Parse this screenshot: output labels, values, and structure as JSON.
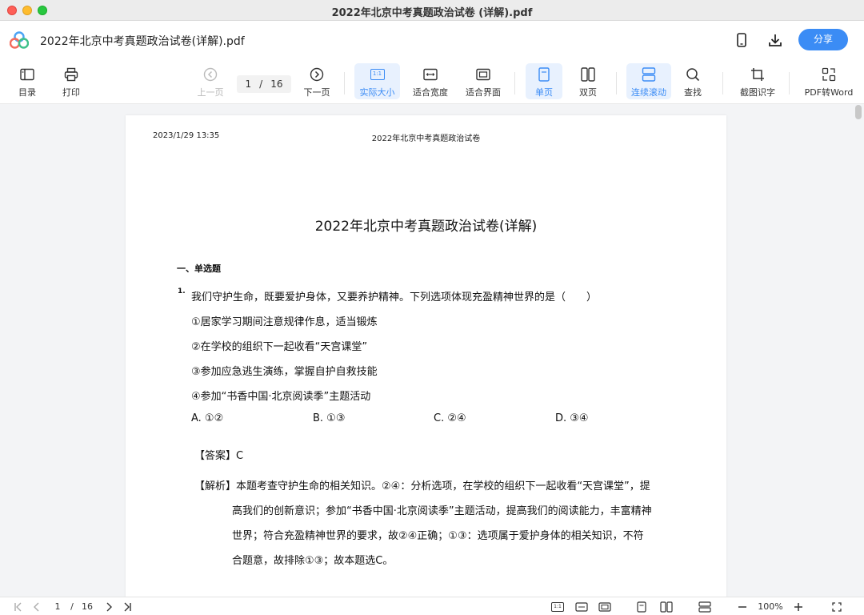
{
  "window": {
    "title": "2022年北京中考真题政治试卷 (详解).pdf"
  },
  "header": {
    "doc_title": "2022年北京中考真题政治试卷(详解).pdf",
    "share_label": "分享"
  },
  "toolbar": {
    "toc": "目录",
    "print": "打印",
    "prev_page": "上一页",
    "current_page": "1",
    "page_sep": "/",
    "total_pages": "16",
    "next_page": "下一页",
    "actual_size": "实际大小",
    "fit_width": "适合宽度",
    "fit_page": "适合界面",
    "single_page": "单页",
    "double_page": "双页",
    "continuous_scroll": "连续滚动",
    "find": "查找",
    "screenshot_ocr": "截图识字",
    "pdf_to_word": "PDF转Word",
    "actual_size_icon_text": "1:1"
  },
  "document": {
    "header_date": "2023/1/29 13:35",
    "header_center": "2022年北京中考真题政治试卷",
    "title": "2022年北京中考真题政治试卷(详解)",
    "section": "一、单选题",
    "question_number": "1.",
    "question_text": "我们守护生命，既要爱护身体，又要养护精神。下列选项体现充盈精神世界的是（　　）",
    "items": [
      "①居家学习期间注意规律作息，适当锻炼",
      "②在学校的组织下一起收看“天宫课堂”",
      "③参加应急逃生演练，掌握自护自救技能",
      "④参加“书香中国·北京阅读季”主题活动"
    ],
    "options": [
      "A. ①②",
      "B. ①③",
      "C. ②④",
      "D. ③④"
    ],
    "answer_label": "【答案】",
    "answer_value": "C",
    "analysis_label": "【解析】",
    "analysis_lines": [
      "本题考查守护生命的相关知识。②④：分析选项，在学校的组织下一起收看“天宫课堂”，提",
      "高我们的创新意识；参加“书香中国·北京阅读季”主题活动，提高我们的阅读能力，丰富精神",
      "世界；符合充盈精神世界的要求，故②④正确；①③：选项属于爱护身体的相关知识，不符",
      "合题意，故排除①③；故本题选C。"
    ]
  },
  "statusbar": {
    "current_page": "1",
    "page_sep": "/",
    "total_pages": "16",
    "actual_size_text": "1:1",
    "zoom": "100%"
  },
  "colors": {
    "accent": "#3b8cf5",
    "active_bg": "#e8f1fe"
  },
  "icons": [
    "app-logo-icon",
    "phone-icon",
    "download-icon",
    "toc-icon",
    "print-icon",
    "prev-page-icon",
    "next-page-icon",
    "actual-size-icon",
    "fit-width-icon",
    "fit-page-icon",
    "single-page-icon",
    "double-page-icon",
    "continuous-scroll-icon",
    "search-icon",
    "screenshot-ocr-icon",
    "pdf-to-word-icon",
    "first-page-icon",
    "last-page-icon",
    "zoom-out-icon",
    "zoom-in-icon",
    "fullscreen-icon"
  ]
}
